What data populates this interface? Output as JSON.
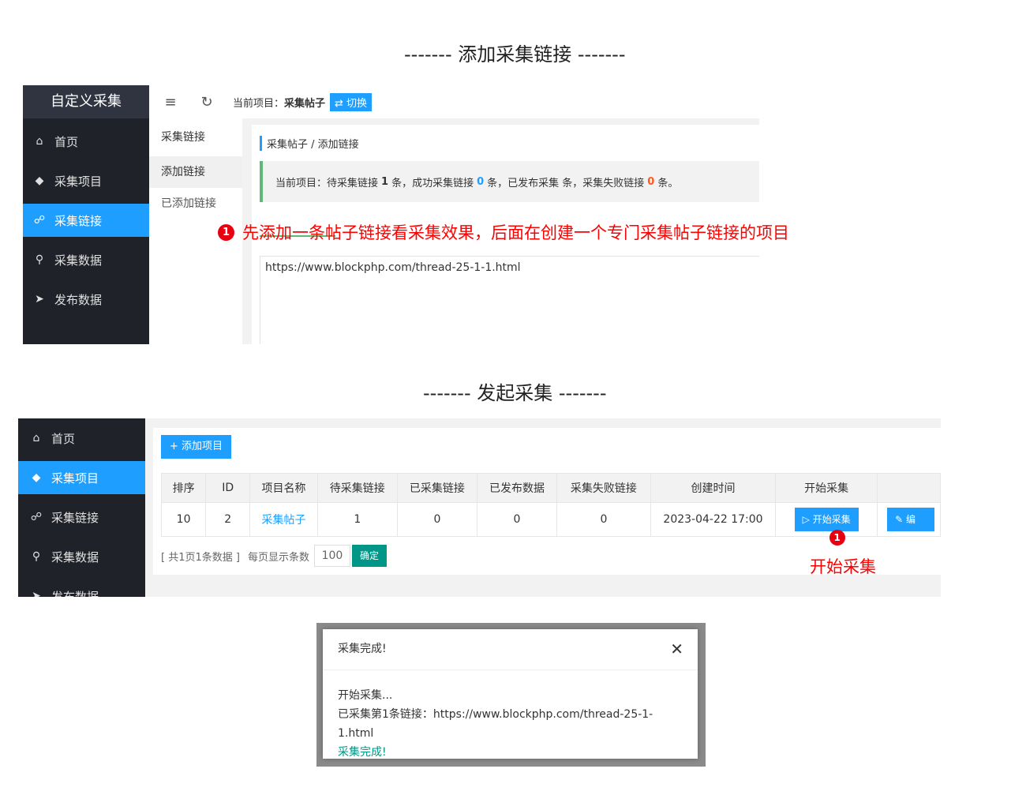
{
  "headings": {
    "section1": "------- 添加采集链接 -------",
    "section2": "------- 发起采集 -------"
  },
  "panel1": {
    "app_title": "自定义采集",
    "sidebar": [
      {
        "label": "首页",
        "icon": "home-icon",
        "active": false
      },
      {
        "label": "采集项目",
        "icon": "layers-icon",
        "active": false
      },
      {
        "label": "采集链接",
        "icon": "link-icon",
        "active": true
      },
      {
        "label": "采集数据",
        "icon": "key-icon",
        "active": false
      },
      {
        "label": "发布数据",
        "icon": "paper-plane-icon",
        "active": false
      }
    ],
    "topbar": {
      "current_label": "当前项目：",
      "current_value": "采集帖子",
      "switch_label": "⇄ 切换"
    },
    "subnav": {
      "header": "采集链接",
      "item_add": "添加链接",
      "item_added": "已添加链接"
    },
    "breadcrumb": "采集帖子 / 添加链接",
    "notice": {
      "prefix": "当前项目：待采集链接",
      "pending": "1",
      "part2": "条，成功采集链接",
      "success": "0",
      "part3": "条，已发布采集 条，采集失败链接",
      "failed": "0",
      "suffix": "条。"
    },
    "textarea_value": "https://www.blockphp.com/thread-25-1-1.html",
    "annotation": {
      "badge": "1",
      "text": "先添加一条帖子链接看采集效果，后面在创建一个专门采集帖子链接的项目"
    }
  },
  "panel2": {
    "sidebar": [
      {
        "label": "首页",
        "icon": "home-icon",
        "active": false
      },
      {
        "label": "采集项目",
        "icon": "layers-icon",
        "active": true
      },
      {
        "label": "采集链接",
        "icon": "link-icon",
        "active": false
      },
      {
        "label": "采集数据",
        "icon": "key-icon",
        "active": false
      },
      {
        "label": "发布数据",
        "icon": "paper-plane-icon",
        "active": false
      }
    ],
    "add_button": "+ 添加项目",
    "table": {
      "headers": [
        "排序",
        "ID",
        "项目名称",
        "待采集链接",
        "已采集链接",
        "已发布数据",
        "采集失败链接",
        "创建时间",
        "开始采集",
        ""
      ],
      "row": {
        "sort": "10",
        "id": "2",
        "name": "采集帖子",
        "pending": "1",
        "collected": "0",
        "published": "0",
        "failed": "0",
        "created": "2023-04-22 17:00",
        "start_button": "开始采集",
        "edit_button": "编"
      }
    },
    "pager": {
      "summary": "[ 共1页1条数据 ]",
      "per_page_label": "每页显示条数",
      "per_page_value": "100",
      "ok": "确定"
    },
    "annotation": {
      "badge": "1",
      "text": "开始采集"
    }
  },
  "dialog": {
    "title": "采集完成!",
    "lines": [
      "开始采集...",
      "已采集第1条链接：https://www.blockphp.com/thread-25-1-1.html"
    ],
    "done": "采集完成!"
  },
  "colors": {
    "sidebar_bg": "#20222a",
    "accent_blue": "#1e9fff",
    "success_green": "#009688",
    "notice_border": "#5fb878",
    "annotation_red": "#ff0000",
    "failed_orange": "#ff5722"
  }
}
